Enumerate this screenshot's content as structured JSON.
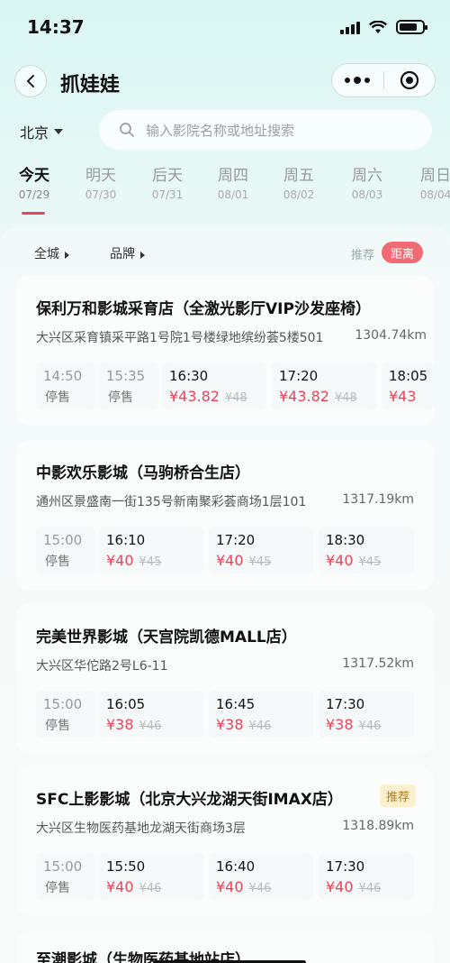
{
  "status_bar": {
    "time": "14:37"
  },
  "nav": {
    "title": "抓娃娃"
  },
  "search": {
    "city": "北京",
    "placeholder": "输入影院名称或地址搜索"
  },
  "dates": [
    {
      "day": "今天",
      "date": "07/29",
      "active": true
    },
    {
      "day": "明天",
      "date": "07/30"
    },
    {
      "day": "后天",
      "date": "07/31"
    },
    {
      "day": "周四",
      "date": "08/01"
    },
    {
      "day": "周五",
      "date": "08/02"
    },
    {
      "day": "周六",
      "date": "08/03"
    },
    {
      "day": "周日",
      "date": "08/04"
    }
  ],
  "filters": {
    "area": "全城",
    "brand": "品牌",
    "sort_recommend": "推荐",
    "sort_distance": "距离"
  },
  "cinemas": [
    {
      "name": "保利万和影城采育店（全激光影厅VIP沙发座椅）",
      "address": "大兴区采育镇采平路1号院1号楼绿地缤纷荟5楼501",
      "distance": "1304.74km",
      "sessions": [
        {
          "time": "14:50",
          "status": "停售"
        },
        {
          "time": "15:35",
          "status": "停售"
        },
        {
          "time": "16:30",
          "price": "¥43.82",
          "orig": "¥48"
        },
        {
          "time": "17:20",
          "price": "¥43.82",
          "orig": "¥48"
        },
        {
          "time": "18:05",
          "price": "¥43"
        }
      ]
    },
    {
      "name": "中影欢乐影城（马驹桥合生店）",
      "address": "通州区景盛南一街135号新南聚彩荟商场1层101",
      "distance": "1317.19km",
      "sessions": [
        {
          "time": "15:00",
          "status": "停售"
        },
        {
          "time": "16:10",
          "price": "¥40",
          "orig": "¥45"
        },
        {
          "time": "17:20",
          "price": "¥40",
          "orig": "¥45"
        },
        {
          "time": "18:30",
          "price": "¥40",
          "orig": "¥45"
        }
      ]
    },
    {
      "name": "完美世界影城（天宫院凯德MALL店）",
      "address": "大兴区华佗路2号L6-11",
      "distance": "1317.52km",
      "sessions": [
        {
          "time": "15:00",
          "status": "停售"
        },
        {
          "time": "16:05",
          "price": "¥38",
          "orig": "¥46"
        },
        {
          "time": "16:45",
          "price": "¥38",
          "orig": "¥46"
        },
        {
          "time": "17:30",
          "price": "¥38",
          "orig": "¥46"
        }
      ]
    },
    {
      "name": "SFC上影影城（北京大兴龙湖天街IMAX店）",
      "tag": "推荐",
      "address": "大兴区生物医药基地龙湖天街商场3层",
      "distance": "1318.89km",
      "sessions": [
        {
          "time": "15:00",
          "status": "停售"
        },
        {
          "time": "15:50",
          "price": "¥40",
          "orig": "¥46"
        },
        {
          "time": "16:40",
          "price": "¥40",
          "orig": "¥46"
        },
        {
          "time": "17:30",
          "price": "¥40",
          "orig": "¥46"
        }
      ]
    },
    {
      "name": "至潮影城（生物医药基地站店）"
    }
  ]
}
